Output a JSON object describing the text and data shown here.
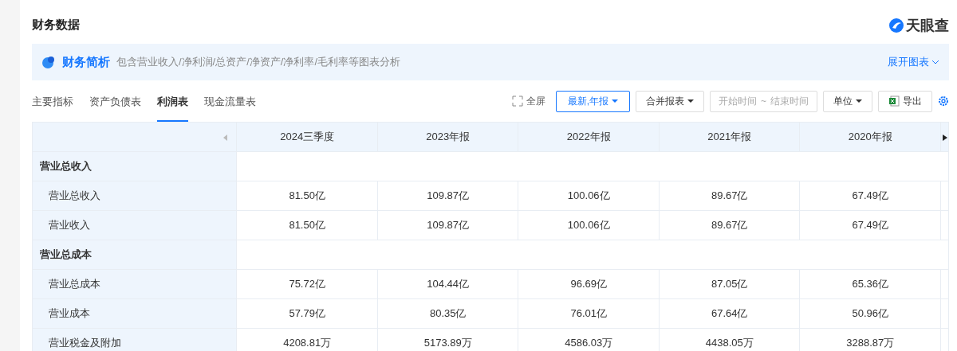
{
  "title": "财务数据",
  "logo": "天眼查",
  "banner": {
    "title": "财务简析",
    "description": "包含营业收入/净利润/总资产/净资产/净利率/毛利率等图表分析",
    "action": "展开图表"
  },
  "tabs": [
    {
      "label": "主要指标",
      "selected": false
    },
    {
      "label": "资产负债表",
      "selected": false
    },
    {
      "label": "利润表",
      "selected": true
    },
    {
      "label": "现金流量表",
      "selected": false
    }
  ],
  "toolbar": {
    "fullscreen": "全屏",
    "period": "最新,年报",
    "report": "合并报表",
    "date_start": "开始时间",
    "date_sep": "~",
    "date_end": "结束时间",
    "unit": "单位",
    "export": "导出"
  },
  "table": {
    "columns": [
      "2024三季度",
      "2023年报",
      "2022年报",
      "2021年报",
      "2020年报"
    ],
    "rows": [
      {
        "kind": "section",
        "label": "营业总收入"
      },
      {
        "kind": "item",
        "label": "营业总收入",
        "values": [
          "81.50亿",
          "109.87亿",
          "100.06亿",
          "89.67亿",
          "67.49亿"
        ]
      },
      {
        "kind": "item",
        "label": "营业收入",
        "values": [
          "81.50亿",
          "109.87亿",
          "100.06亿",
          "89.67亿",
          "67.49亿"
        ]
      },
      {
        "kind": "section",
        "label": "营业总成本"
      },
      {
        "kind": "item",
        "label": "营业总成本",
        "values": [
          "75.72亿",
          "104.44亿",
          "96.69亿",
          "87.05亿",
          "65.36亿"
        ]
      },
      {
        "kind": "item",
        "label": "营业成本",
        "values": [
          "57.79亿",
          "80.35亿",
          "76.01亿",
          "67.64亿",
          "50.96亿"
        ]
      },
      {
        "kind": "item",
        "label": "营业税金及附加",
        "values": [
          "4208.81万",
          "5173.89万",
          "4586.03万",
          "4438.05万",
          "3288.87万"
        ]
      }
    ]
  }
}
